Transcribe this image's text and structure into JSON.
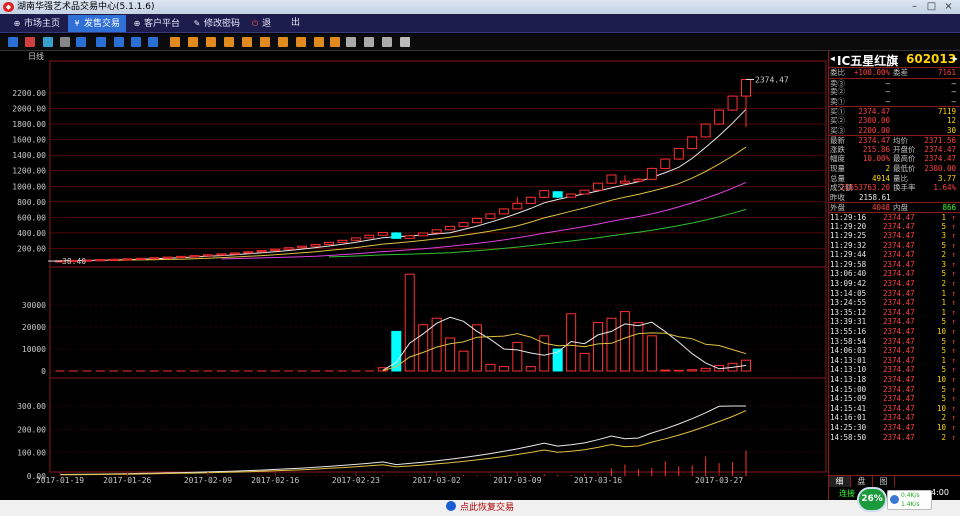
{
  "window": {
    "title": "湖南华强艺术品交易中心(5.1.1.6)",
    "controls": [
      "minimize",
      "maximize",
      "close"
    ]
  },
  "menu": [
    {
      "label": "市场主页",
      "icon": "globe-icon",
      "active": false
    },
    {
      "label": "发售交易",
      "icon": "yen-icon",
      "active": true
    },
    {
      "label": "客户平台",
      "icon": "globe-icon",
      "active": false
    },
    {
      "label": "修改密码",
      "icon": "pencil-icon",
      "active": false
    },
    {
      "label": "退",
      "icon": "power-icon",
      "active": false
    },
    {
      "label": "出",
      "icon": "",
      "active": false
    }
  ],
  "toolbar": [
    "bar-chart-icon",
    "line-chart-icon",
    "candle-icon",
    "calculator-icon",
    "zoom-box-icon",
    "period-1-icon",
    "period-2-icon",
    "period-3-icon",
    "period-x-icon",
    "tool-1-icon",
    "tool-2-icon",
    "tool-3-icon",
    "tool-4-icon",
    "tool-5-icon",
    "tool-6-icon",
    "tool-7-icon",
    "tool-8-icon",
    "tool-9-icon",
    "tool-10-icon",
    "zoom-in-icon",
    "zoom-out-icon",
    "chart-draw-icon",
    "settings-icon"
  ],
  "chart_data": {
    "type": "candlestick",
    "period_label": "日线",
    "price_ticks": [
      "2200.00",
      "2000.00",
      "1800.00",
      "1600.00",
      "1400.00",
      "1200.00",
      "1000.00",
      "800.00",
      "600.00",
      "400.00",
      "200.00"
    ],
    "price_values": [
      2200,
      2000,
      1800,
      1600,
      1400,
      1200,
      1000,
      800,
      600,
      400,
      200
    ],
    "volume_ticks": [
      "30000",
      "20000",
      "10000",
      "0"
    ],
    "volume_values": [
      30000,
      20000,
      10000,
      0
    ],
    "indicator_ticks": [
      "300.00",
      "200.00",
      "100.00",
      "0.00"
    ],
    "indicator_values": [
      300,
      200,
      100,
      0
    ],
    "date_labels": [
      "2017-01-19",
      "2017-01-26",
      "2017-02-09",
      "2017-02-16",
      "2017-02-23",
      "2017-03-02",
      "2017-03-09",
      "2017-03-16",
      "2017-03-27"
    ],
    "low_annotation": "38.40",
    "high_annotation": "2374.47",
    "candles": [
      {
        "o": 38,
        "c": 42,
        "h": 44,
        "l": 38,
        "v": 0
      },
      {
        "o": 42,
        "c": 46,
        "h": 48,
        "l": 40,
        "v": 0
      },
      {
        "o": 46,
        "c": 51,
        "h": 53,
        "l": 45,
        "v": 0
      },
      {
        "o": 51,
        "c": 56,
        "h": 58,
        "l": 50,
        "v": 0
      },
      {
        "o": 56,
        "c": 61,
        "h": 63,
        "l": 55,
        "v": 0
      },
      {
        "o": 61,
        "c": 67,
        "h": 69,
        "l": 60,
        "v": 0
      },
      {
        "o": 67,
        "c": 74,
        "h": 76,
        "l": 66,
        "v": 0
      },
      {
        "o": 74,
        "c": 81,
        "h": 83,
        "l": 73,
        "v": 0
      },
      {
        "o": 81,
        "c": 89,
        "h": 91,
        "l": 80,
        "v": 0
      },
      {
        "o": 89,
        "c": 98,
        "h": 100,
        "l": 88,
        "v": 0
      },
      {
        "o": 98,
        "c": 107,
        "h": 109,
        "l": 97,
        "v": 0
      },
      {
        "o": 107,
        "c": 118,
        "h": 120,
        "l": 106,
        "v": 0
      },
      {
        "o": 118,
        "c": 130,
        "h": 132,
        "l": 117,
        "v": 0
      },
      {
        "o": 130,
        "c": 142,
        "h": 145,
        "l": 129,
        "v": 0
      },
      {
        "o": 142,
        "c": 157,
        "h": 159,
        "l": 141,
        "v": 0
      },
      {
        "o": 157,
        "c": 172,
        "h": 175,
        "l": 156,
        "v": 0
      },
      {
        "o": 172,
        "c": 190,
        "h": 193,
        "l": 171,
        "v": 0
      },
      {
        "o": 190,
        "c": 209,
        "h": 212,
        "l": 188,
        "v": 0
      },
      {
        "o": 209,
        "c": 229,
        "h": 232,
        "l": 207,
        "v": 0
      },
      {
        "o": 229,
        "c": 252,
        "h": 256,
        "l": 227,
        "v": 0
      },
      {
        "o": 252,
        "c": 278,
        "h": 282,
        "l": 250,
        "v": 0
      },
      {
        "o": 278,
        "c": 305,
        "h": 309,
        "l": 276,
        "v": 0
      },
      {
        "o": 305,
        "c": 336,
        "h": 340,
        "l": 303,
        "v": 0
      },
      {
        "o": 336,
        "c": 370,
        "h": 374,
        "l": 333,
        "v": 0
      },
      {
        "o": 370,
        "c": 406,
        "h": 410,
        "l": 367,
        "v": 1500
      },
      {
        "o": 400,
        "c": 330,
        "h": 410,
        "l": 325,
        "v": 18000
      },
      {
        "o": 330,
        "c": 363,
        "h": 368,
        "l": 325,
        "v": 44000
      },
      {
        "o": 363,
        "c": 399,
        "h": 404,
        "l": 358,
        "v": 21000
      },
      {
        "o": 399,
        "c": 440,
        "h": 445,
        "l": 394,
        "v": 24000
      },
      {
        "o": 440,
        "c": 484,
        "h": 490,
        "l": 434,
        "v": 15000
      },
      {
        "o": 484,
        "c": 532,
        "h": 539,
        "l": 478,
        "v": 9000
      },
      {
        "o": 532,
        "c": 586,
        "h": 593,
        "l": 526,
        "v": 21000
      },
      {
        "o": 586,
        "c": 645,
        "h": 652,
        "l": 579,
        "v": 3000
      },
      {
        "o": 645,
        "c": 709,
        "h": 717,
        "l": 637,
        "v": 2000
      },
      {
        "o": 709,
        "c": 780,
        "h": 860,
        "l": 701,
        "v": 13000
      },
      {
        "o": 780,
        "c": 858,
        "h": 868,
        "l": 771,
        "v": 2000
      },
      {
        "o": 858,
        "c": 944,
        "h": 955,
        "l": 848,
        "v": 16000
      },
      {
        "o": 930,
        "c": 860,
        "h": 935,
        "l": 850,
        "v": 10000
      },
      {
        "o": 860,
        "c": 900,
        "h": 905,
        "l": 855,
        "v": 26000
      },
      {
        "o": 900,
        "c": 950,
        "h": 955,
        "l": 895,
        "v": 8000
      },
      {
        "o": 950,
        "c": 1040,
        "h": 1048,
        "l": 940,
        "v": 22000
      },
      {
        "o": 1040,
        "c": 1145,
        "h": 1152,
        "l": 1030,
        "v": 24000
      },
      {
        "o": 1040,
        "c": 1065,
        "h": 1140,
        "l": 1030,
        "v": 27000
      },
      {
        "o": 1065,
        "c": 1090,
        "h": 1105,
        "l": 1060,
        "v": 22000
      },
      {
        "o": 1090,
        "c": 1230,
        "h": 1240,
        "l": 1080,
        "v": 16000
      },
      {
        "o": 1230,
        "c": 1350,
        "h": 1360,
        "l": 1220,
        "v": 400
      },
      {
        "o": 1350,
        "c": 1485,
        "h": 1495,
        "l": 1340,
        "v": 300
      },
      {
        "o": 1485,
        "c": 1635,
        "h": 1645,
        "l": 1475,
        "v": 600
      },
      {
        "o": 1635,
        "c": 1800,
        "h": 1810,
        "l": 1625,
        "v": 1200
      },
      {
        "o": 1800,
        "c": 1980,
        "h": 1990,
        "l": 1790,
        "v": 2500
      },
      {
        "o": 1980,
        "c": 2160,
        "h": 2170,
        "l": 1970,
        "v": 3500
      },
      {
        "o": 2160,
        "c": 2374,
        "h": 2374,
        "l": 1760,
        "v": 4914
      }
    ]
  },
  "quote": {
    "name": "IC五星红旗",
    "code": "602013",
    "weibi": {
      "label": "委比",
      "value": "+100.00%",
      "label2": "委差",
      "value2": "7161"
    },
    "sell": [
      {
        "label": "卖③",
        "price": "—",
        "qty": "—"
      },
      {
        "label": "卖②",
        "price": "—",
        "qty": "—"
      },
      {
        "label": "卖①",
        "price": "—",
        "qty": "—"
      }
    ],
    "buy": [
      {
        "label": "买①",
        "price": "2374.47",
        "qty": "7119"
      },
      {
        "label": "买②",
        "price": "2300.00",
        "qty": "12"
      },
      {
        "label": "买③",
        "price": "2200.00",
        "qty": "30"
      }
    ],
    "stats": [
      {
        "l1": "最新",
        "v1": "2374.47",
        "l2": "均价",
        "v2": "2371.56"
      },
      {
        "l1": "涨跌",
        "v1": "215.86",
        "l2": "开盘价",
        "v2": "2374.47"
      },
      {
        "l1": "幅度",
        "v1": "10.00%",
        "l2": "最高价",
        "v2": "2374.47"
      },
      {
        "l1": "现量",
        "v1": "2",
        "l2": "最低价",
        "v2": "2300.00"
      },
      {
        "l1": "总量",
        "v1": "4914",
        "l2": "量比",
        "v2": "3.77"
      },
      {
        "l1": "成交额",
        "v1": "11653763.20",
        "l2": "换手率",
        "v2": "1.64%"
      }
    ],
    "prev_close": {
      "label": "昨收",
      "value": "2158.61"
    },
    "outer": {
      "label": "外盘",
      "value": "4048",
      "label2": "内盘",
      "value2": "866"
    },
    "ticks": [
      {
        "t": "11:29:16",
        "p": "2374.47",
        "q": "1"
      },
      {
        "t": "11:29:20",
        "p": "2374.47",
        "q": "5"
      },
      {
        "t": "11:29:25",
        "p": "2374.47",
        "q": "3"
      },
      {
        "t": "11:29:32",
        "p": "2374.47",
        "q": "5"
      },
      {
        "t": "11:29:44",
        "p": "2374.47",
        "q": "2"
      },
      {
        "t": "11:29:58",
        "p": "2374.47",
        "q": "3"
      },
      {
        "t": "13:06:40",
        "p": "2374.47",
        "q": "5"
      },
      {
        "t": "13:09:42",
        "p": "2374.47",
        "q": "2"
      },
      {
        "t": "13:14:05",
        "p": "2374.47",
        "q": "1"
      },
      {
        "t": "13:24:55",
        "p": "2374.47",
        "q": "1"
      },
      {
        "t": "13:35:12",
        "p": "2374.47",
        "q": "1"
      },
      {
        "t": "13:39:31",
        "p": "2374.47",
        "q": "5"
      },
      {
        "t": "13:55:16",
        "p": "2374.47",
        "q": "10"
      },
      {
        "t": "13:58:54",
        "p": "2374.47",
        "q": "5"
      },
      {
        "t": "14:06:03",
        "p": "2374.47",
        "q": "5"
      },
      {
        "t": "14:13:01",
        "p": "2374.47",
        "q": "1"
      },
      {
        "t": "14:13:10",
        "p": "2374.47",
        "q": "5"
      },
      {
        "t": "14:13:18",
        "p": "2374.47",
        "q": "10"
      },
      {
        "t": "14:15:00",
        "p": "2374.47",
        "q": "5"
      },
      {
        "t": "14:15:09",
        "p": "2374.47",
        "q": "5"
      },
      {
        "t": "14:15:41",
        "p": "2374.47",
        "q": "10"
      },
      {
        "t": "14:16:01",
        "p": "2374.47",
        "q": "2"
      },
      {
        "t": "14:25:30",
        "p": "2374.47",
        "q": "10"
      },
      {
        "t": "14:58:50",
        "p": "2374.47",
        "q": "2"
      }
    ],
    "tabs": [
      "细",
      "盘",
      "图"
    ],
    "footer": {
      "left": "连接",
      "time": "4:00"
    }
  },
  "status": {
    "restore_label": "点此恢复交易"
  },
  "gauge": {
    "percent": "26%",
    "net_up": "0.4K/s",
    "net_down": "1.4K/s"
  }
}
